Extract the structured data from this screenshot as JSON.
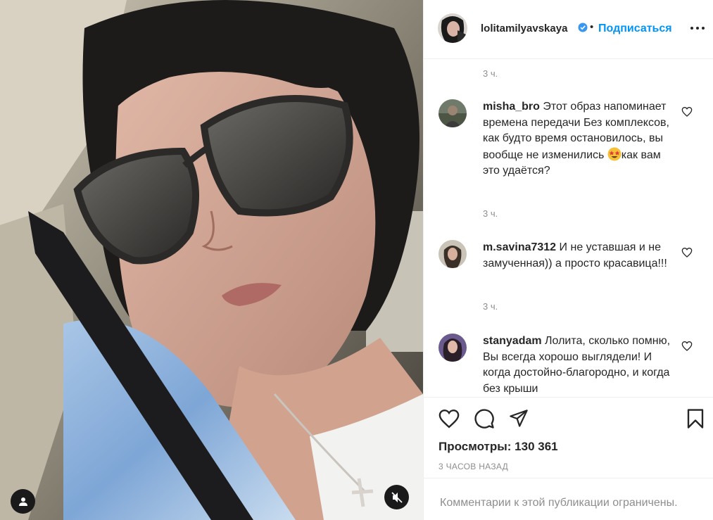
{
  "post": {
    "username": "lolitamilyavskaya",
    "separator": "•",
    "follow_label": "Подписаться",
    "more_icon": "more-icon"
  },
  "comments": {
    "top_time": "3 ч.",
    "items": [
      {
        "user": "misha_bro",
        "text_before_emoji": "Этот образ напоминает времена передачи Без комплексов, как будто время остановилось, вы вообще не изменились ",
        "emoji": "star-struck-emoji",
        "text_after_emoji": "как вам это удаётся?",
        "time": "3 ч."
      },
      {
        "user": "m.savina7312",
        "text": "И не уставшая и не замученная)) а просто красавица!!!",
        "time": "3 ч."
      },
      {
        "user": "stanyadam",
        "text": "Лолита, сколько помню, Вы всегда хорошо выглядели! И когда достойно-благородно, и когда без крыши",
        "time": ""
      }
    ]
  },
  "actions": {
    "views_label": "Просмотры:",
    "views_count": "130 361",
    "posted": "3 ЧАСОВ НАЗАД"
  },
  "comments_limited": "Комментарии к этой публикации ограничены.",
  "colors": {
    "accent": "#0095f6",
    "secondary_text": "#8e8e8e",
    "border": "#efefef"
  }
}
